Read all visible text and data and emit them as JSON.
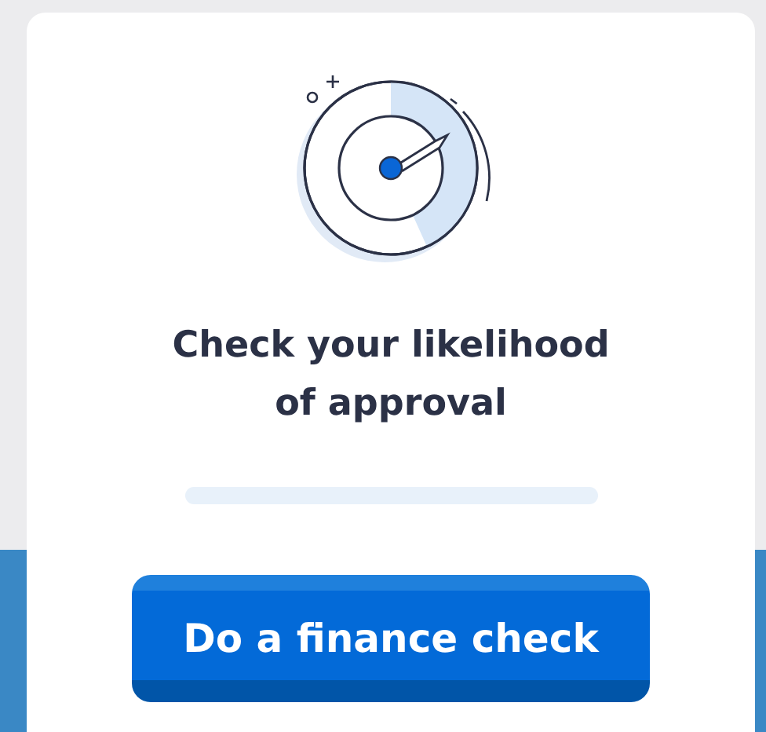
{
  "card": {
    "heading": "Check your likelihood of approval",
    "button": "Do a finance check"
  }
}
